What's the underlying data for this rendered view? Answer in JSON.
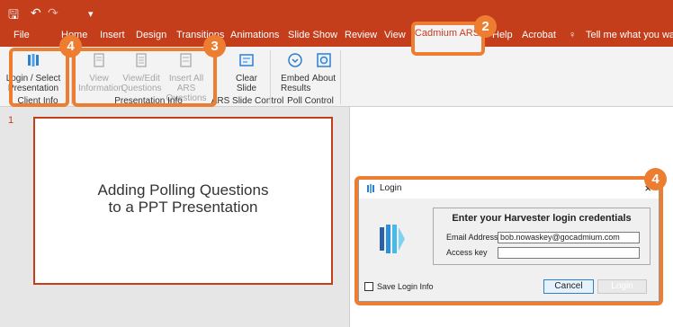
{
  "quick_access": {
    "save": "🖫",
    "undo": "↶",
    "redo": "↷",
    "more": "▾"
  },
  "tabs": [
    {
      "label": "File"
    },
    {
      "label": "Home"
    },
    {
      "label": "Insert"
    },
    {
      "label": "Design"
    },
    {
      "label": "Transitions"
    },
    {
      "label": "Animations"
    },
    {
      "label": "Slide Show"
    },
    {
      "label": "Review"
    },
    {
      "label": "View"
    },
    {
      "label": "Cadmium ARS"
    },
    {
      "label": "Help"
    },
    {
      "label": "Acrobat"
    }
  ],
  "tell_me": "Tell me what you want to",
  "ribbon": {
    "login_select": "Login / Select\nPresentation",
    "view_info": "View\nInformation",
    "view_edit": "View/Edit\nQuestions",
    "insert_all": "Insert All ARS\nQuestions",
    "clear_slide": "Clear\nSlide",
    "embed_results": "Embed\nResults",
    "about": "About",
    "groups": {
      "client_info": "Client Info",
      "presentation_info": "Presentation Info",
      "ars_slide_control": "ARS Slide Control",
      "poll_control": "Poll Control"
    }
  },
  "slide": {
    "number": "1",
    "title": "Adding Polling Questions\nto a PPT Presentation"
  },
  "dialog": {
    "title": "Login",
    "close": "×",
    "heading": "Enter your Harvester login credentials",
    "email_label": "Email Address",
    "email_value": "bob.nowaskey@gocadmium.com",
    "key_label": "Access key",
    "key_value": "",
    "save_label": "Save Login Info",
    "cancel_label": "Cancel",
    "login_label": "Login"
  },
  "callouts": {
    "c1": "4",
    "c2": "2",
    "c3": "3",
    "c4": "4"
  },
  "colors": {
    "accent": "#c43e1c",
    "callout": "#ed7d31"
  }
}
